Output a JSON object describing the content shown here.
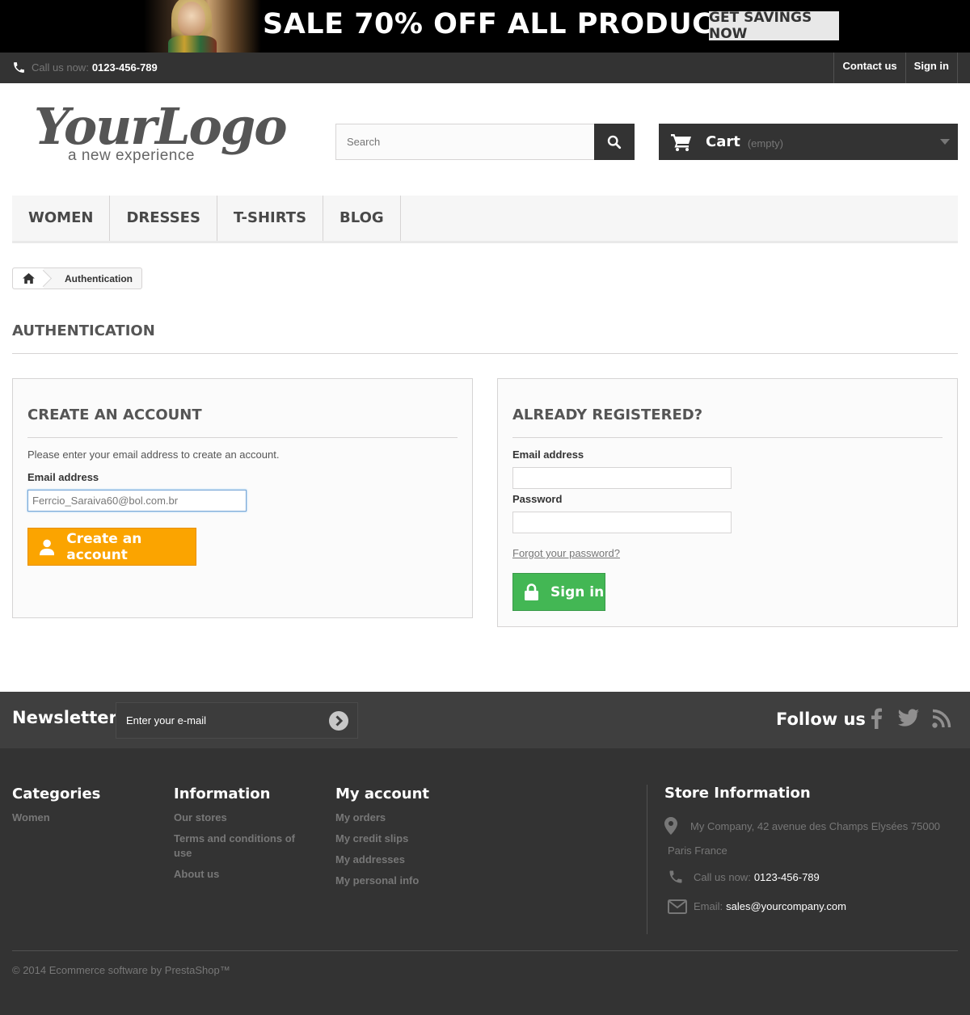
{
  "banner": {
    "headline": "SALE 70% OFF ALL PRODUCTS",
    "button": "GET SAVINGS NOW"
  },
  "topnav": {
    "call_label": "Call us now:",
    "call_number": "0123-456-789",
    "contact_us": "Contact us",
    "sign_in": "Sign in"
  },
  "logo": {
    "main": "YourLogo",
    "tagline": "a new experience"
  },
  "search": {
    "placeholder": "Search"
  },
  "cart": {
    "label": "Cart",
    "status": "(empty)"
  },
  "menu": {
    "items": [
      "WOMEN",
      "DRESSES",
      "T-SHIRTS",
      "BLOG"
    ]
  },
  "breadcrumb": {
    "current": "Authentication"
  },
  "page": {
    "title": "AUTHENTICATION"
  },
  "create_account": {
    "title": "CREATE AN ACCOUNT",
    "description": "Please enter your email address to create an account.",
    "email_label": "Email address",
    "email_value": "Ferrcio_Saraiva60@bol.com.br",
    "button": "Create an account"
  },
  "login": {
    "title": "ALREADY REGISTERED?",
    "email_label": "Email address",
    "password_label": "Password",
    "forgot": "Forgot your password?",
    "button": "Sign in"
  },
  "newsletter": {
    "title": "Newsletter",
    "placeholder": "Enter your e-mail",
    "follow": "Follow us"
  },
  "footer": {
    "categories": {
      "title": "Categories",
      "links": [
        "Women"
      ]
    },
    "information": {
      "title": "Information",
      "links": [
        "Our stores",
        "Terms and conditions of use",
        "About us"
      ]
    },
    "my_account": {
      "title": "My account",
      "links": [
        "My orders",
        "My credit slips",
        "My addresses",
        "My personal info"
      ]
    },
    "store": {
      "title": "Store Information",
      "address_line1": "My Company, 42 avenue des Champs Elysées 75000",
      "address_line2": "Paris France",
      "call_label": "Call us now:",
      "call_number": "0123-456-789",
      "email_label": "Email:",
      "email": "sales@yourcompany.com"
    },
    "copyright": "© 2014 Ecommerce software by PrestaShop™"
  },
  "colors": {
    "dark": "#333333",
    "create_button": "#fba400",
    "signin_button": "#43b754"
  }
}
